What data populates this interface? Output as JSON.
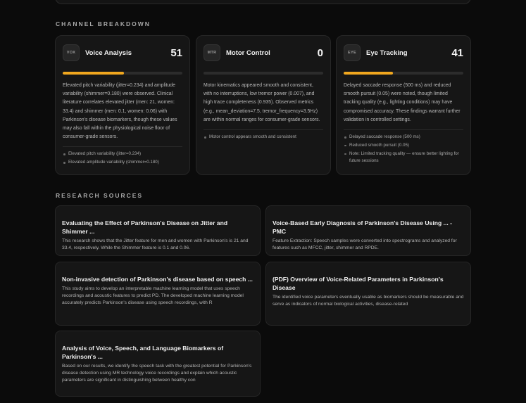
{
  "channel_breakdown": {
    "title": "CHANNEL BREAKDOWN",
    "channels": [
      {
        "badge": "VOX",
        "name": "Voice Analysis",
        "score": "51",
        "progress": 0.51,
        "description": "Elevated pitch variability (jitter=0.234) and amplitude variability (shimmer=0.180) were observed. Clinical literature correlates elevated jitter (men: 21, women: 33.4) and shimmer (men: 0.1, women: 0.06) with Parkinson's disease biomarkers, though these values may also fall within the physiological noise floor of consumer-grade sensors.",
        "bullets": [
          "Elevated pitch variability (jitter=0.234)",
          "Elevated amplitude variability (shimmer=0.180)"
        ]
      },
      {
        "badge": "MTR",
        "name": "Motor Control",
        "score": "0",
        "progress": 0.0,
        "description": "Motor kinematics appeared smooth and consistent, with no interruptions, low tremor power (0.007), and high trace completeness (0.935). Observed metrics (e.g., mean_deviation=7.5, tremor_frequency=3.5Hz) are within normal ranges for consumer-grade sensors.",
        "bullets": [
          "Motor control appears smooth and consistent"
        ]
      },
      {
        "badge": "EYE",
        "name": "Eye Tracking",
        "score": "41",
        "progress": 0.41,
        "description": "Delayed saccade response (500 ms) and reduced smooth pursuit (0.05) were noted, though limited tracking quality (e.g., lighting conditions) may have compromised accuracy. These findings warrant further validation in controlled settings.",
        "bullets": [
          "Delayed saccade response (500 ms)",
          "Reduced smooth pursuit (0.05)",
          "Note: Limited tracking quality — ensure better lighting for future sessions"
        ]
      }
    ]
  },
  "research_sources": {
    "title": "RESEARCH SOURCES",
    "items": [
      {
        "title": "Evaluating the Effect of Parkinson's Disease on Jitter and Shimmer ...",
        "snippet": "This research shows that the Jitter feature for men and women with Parkinson's is 21 and 33.4, respectively. While the Shimmer feature is 0.1 and 0.06."
      },
      {
        "title": "Voice-Based Early Diagnosis of Parkinson's Disease Using ... - PMC",
        "snippet": "Feature Extraction: Speech samples were converted into spectrograms and analyzed for features such as MFCC, jitter, shimmer and RPDE."
      },
      {
        "title": "Non-invasive detection of Parkinson's disease based on speech ...",
        "snippet": "This study aims to develop an interpretable machine learning model that uses speech recordings and acoustic features to predict PD. The developed machine learning model accurately predicts Parkinson's disease using speech recordings, with R"
      },
      {
        "title": "(PDF) Overview of Voice-Related Parameters in Parkinson's Disease",
        "snippet": "The identified voice parameters eventually usable as biomarkers should be measurable and serve as indicators of normal biological activities, disease-related"
      },
      {
        "title": "Analysis of Voice, Speech, and Language Biomarkers of Parkinson's ...",
        "snippet": "Based on our results, we identify the speech task with the greatest potential for Parkinson's disease detection using MR technology voice recordings and explain which acoustic parameters are significant in distinguishing between healthy con"
      }
    ]
  },
  "colors": {
    "accent": "#f0a71f",
    "background": "#0b0b0b",
    "card": "#161616"
  }
}
